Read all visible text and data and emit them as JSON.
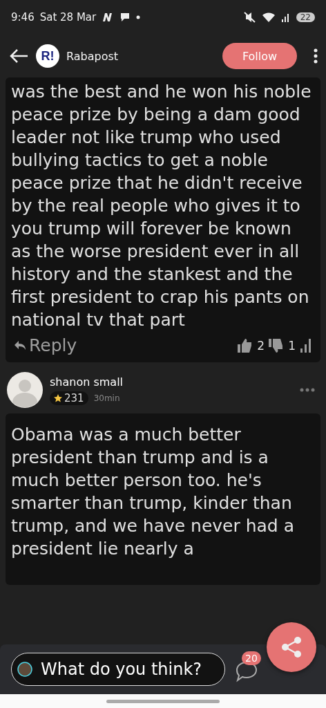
{
  "status_bar": {
    "time": "9:46",
    "date": "Sat 28 Mar",
    "battery": "22"
  },
  "app_bar": {
    "logo": "R!",
    "title": "Rabapost",
    "follow": "Follow"
  },
  "comments": [
    {
      "body": "was the best and he won his noble peace prize by being a dam good leader not like trump who used bullying tactics to get a noble peace prize that he didn't receive by the real people who gives it to you trump will forever be known as the worse president ever in all history and the stankest and the first president to crap his pants on national tv that part",
      "reply": "Reply",
      "likes": "2",
      "dislikes": "1"
    },
    {
      "author": "shanon small",
      "points": "231",
      "age": "30min",
      "body": "Obama was a much better president than trump and is a much better person too. he's smarter than trump, kinder than trump, and we have never had a president lie nearly a"
    }
  ],
  "composer": {
    "placeholder": "What do you think?",
    "count": "20"
  }
}
